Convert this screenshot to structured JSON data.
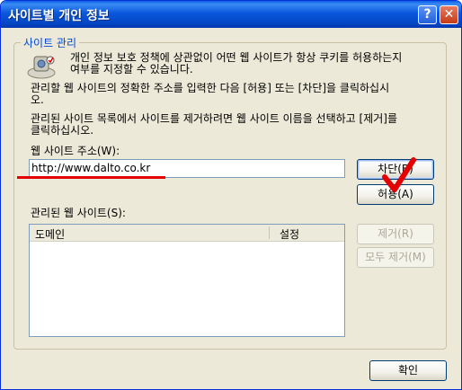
{
  "window": {
    "title": "사이트별 개인 정보",
    "help_label": "?",
    "close_label": "✕"
  },
  "group": {
    "title": "사이트 관리",
    "info_text": [
      "개인 정보 보호 정책에 상관없이 어떤 웹 사이트가 항상 쿠키를 허용하는지",
      "여부를 지정할 수 있습니다."
    ],
    "instruction_text": [
      "관리할 웹 사이트의 정확한 주소를 입력한 다음 [허용] 또는 [차단]을 클릭하십시",
      "오."
    ],
    "remove_text": [
      "관리된 사이트 목록에서 사이트를 제거하려면 웹 사이트 이름을 선택하고 [제거]를",
      "클릭하십시오."
    ]
  },
  "address": {
    "label": "웹 사이트 주소(W):",
    "value": "http://www.dalto.co.kr"
  },
  "buttons": {
    "block": "차단(B)",
    "allow": "허용(A)",
    "remove": "제거(R)",
    "remove_all": "모두 제거(M)",
    "ok": "확인"
  },
  "managed": {
    "label": "관리된 웹 사이트(S):",
    "columns": [
      "도메인",
      "설정"
    ]
  },
  "colors": {
    "annotation_red": "#e40000",
    "group_title": "#0046d5",
    "title_bar": "#0a57dc"
  }
}
